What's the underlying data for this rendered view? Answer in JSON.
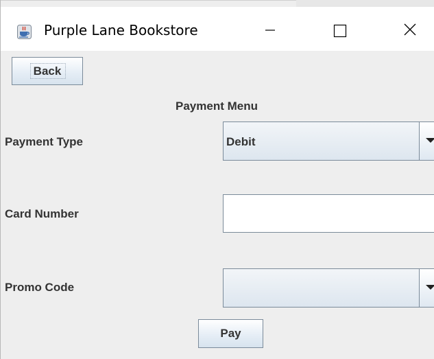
{
  "window": {
    "title": "Purple Lane Bookstore",
    "icon": "java-coffee-cup-icon",
    "controls": {
      "minimize_icon": "minimize-icon",
      "maximize_icon": "maximize-icon",
      "close_icon": "close-icon"
    }
  },
  "toolbar": {
    "back_label": "Back"
  },
  "form": {
    "title": "Payment Menu",
    "payment_type": {
      "label": "Payment Type",
      "selected": "Debit"
    },
    "card_number": {
      "label": "Card Number",
      "value": ""
    },
    "promo_code": {
      "label": "Promo Code",
      "selected": ""
    },
    "pay_label": "Pay"
  },
  "colors": {
    "window_bg": "#eeeeee",
    "titlebar_bg": "#ffffff",
    "text": "#333333",
    "border": "#7a8a99"
  }
}
